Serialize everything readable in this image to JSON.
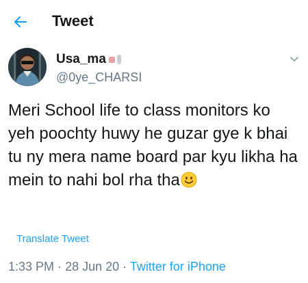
{
  "header": {
    "title": "Tweet",
    "back_icon": "arrow-left-icon",
    "accent": "#1da1f2"
  },
  "author": {
    "display_name": "Usa_ma",
    "handle": "@0ye_CHARSI",
    "avatar_icon": "user-avatar",
    "menu_icon": "chevron-down-icon"
  },
  "tweet": {
    "text": "Meri School life to class monitors ko yeh poochty huwy he guzar gye k bhai tu ny mera name board par kyu likha ha mein to nahi bol rha tha",
    "emoji_icon": "smiley-emoji-icon"
  },
  "translate": {
    "label": "Translate Tweet"
  },
  "meta": {
    "time": "1:33 PM",
    "separator": "·",
    "date": "28 Jun 20",
    "source": "Twitter for iPhone"
  },
  "colors": {
    "text": "#14171a",
    "secondary": "#657786",
    "link": "#1da1f2"
  }
}
